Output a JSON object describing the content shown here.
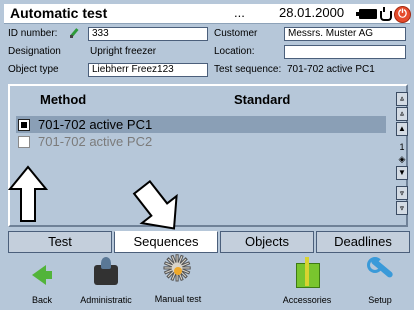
{
  "titlebar": {
    "title": "Automatic test",
    "dots": "...",
    "date": "28.01.2000",
    "power_symbol": "⏻"
  },
  "info": {
    "id_label": "ID number:",
    "id_value": "333",
    "customer_label": "Customer",
    "customer_value": "Messrs. Muster AG",
    "designation_label": "Designation",
    "designation_value": "Upright freezer",
    "location_label": "Location:",
    "location_value": "",
    "object_type_label": "Object type",
    "object_type_value": "Liebherr Freez123",
    "test_sequence_label": "Test sequence:",
    "test_sequence_value": "701-702 active PC1"
  },
  "panel": {
    "col_method": "Method",
    "col_standard": "Standard",
    "rows": [
      {
        "method": "701-702 active PC1",
        "checked": true
      },
      {
        "method": "701-702 active PC2",
        "checked": false
      }
    ],
    "page_number": "1"
  },
  "tabs": [
    "Test",
    "Sequences",
    "Objects",
    "Deadlines"
  ],
  "active_tab": "Sequences",
  "toolbar": {
    "back": "Back",
    "administration": "Administratic",
    "manual_test": "Manual test",
    "accessories": "Accessories",
    "setup": "Setup"
  },
  "icons": {
    "back": "green-arrow-left-icon",
    "administration": "administration-icon",
    "manual_test": "gear-icon",
    "accessories": "gift-box-icon",
    "setup": "wrench-icon"
  },
  "colors": {
    "background": "#b6c7d9",
    "selected_row": "#8a9fb6",
    "power_button": "#e54b2b"
  }
}
